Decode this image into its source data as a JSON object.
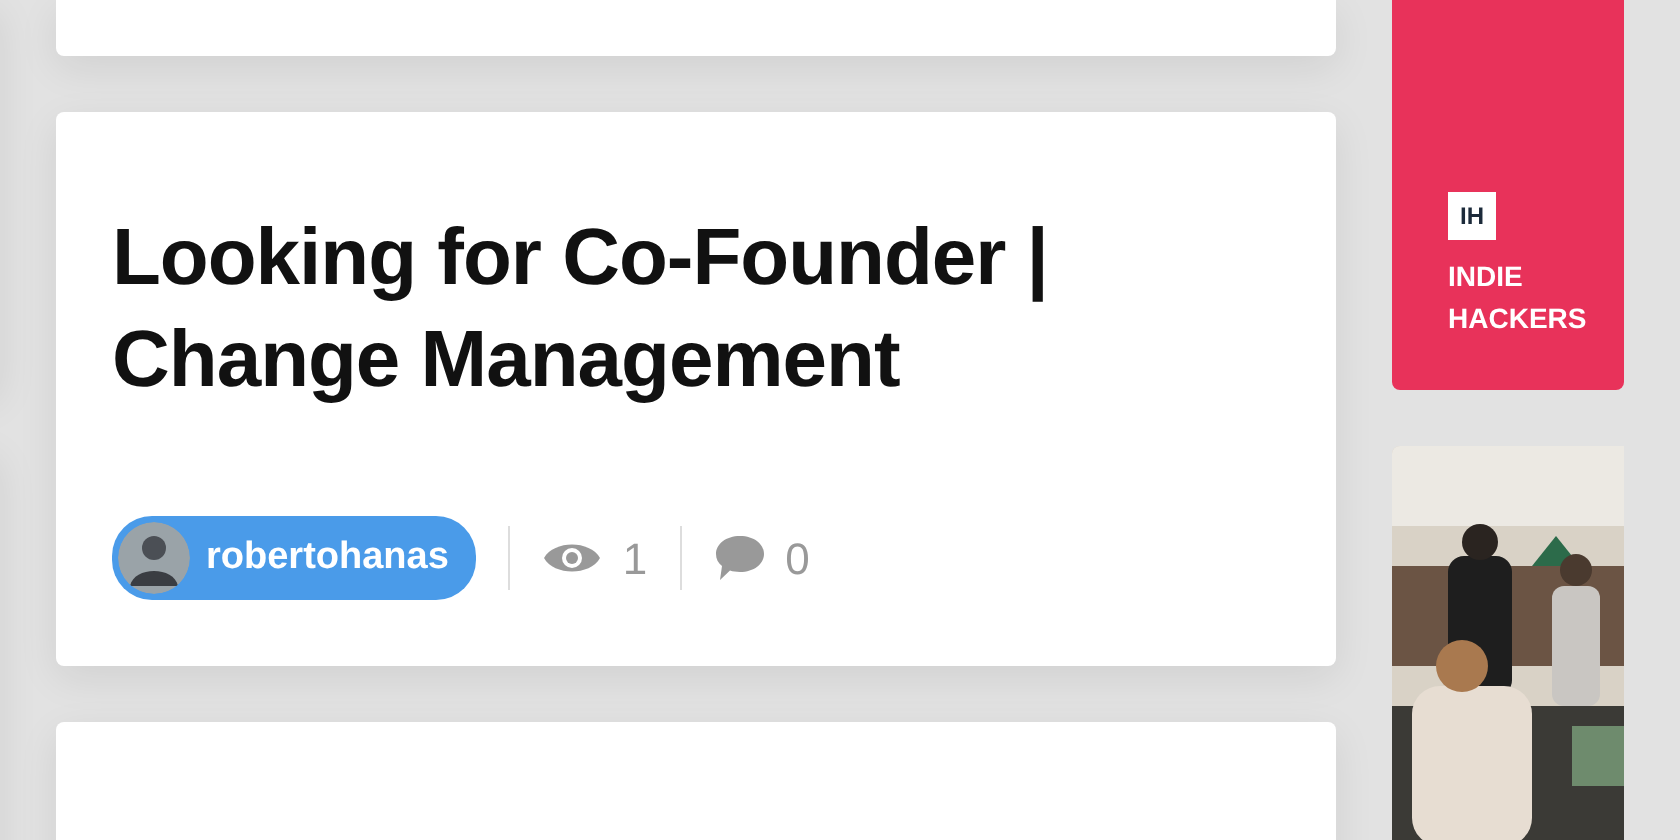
{
  "post": {
    "title": "Looking for Co-Founder | Change Management",
    "author": "robertohanas",
    "views": "1",
    "comments": "0"
  },
  "promo": {
    "logo": "IH",
    "name": "INDIE HACKERS"
  }
}
